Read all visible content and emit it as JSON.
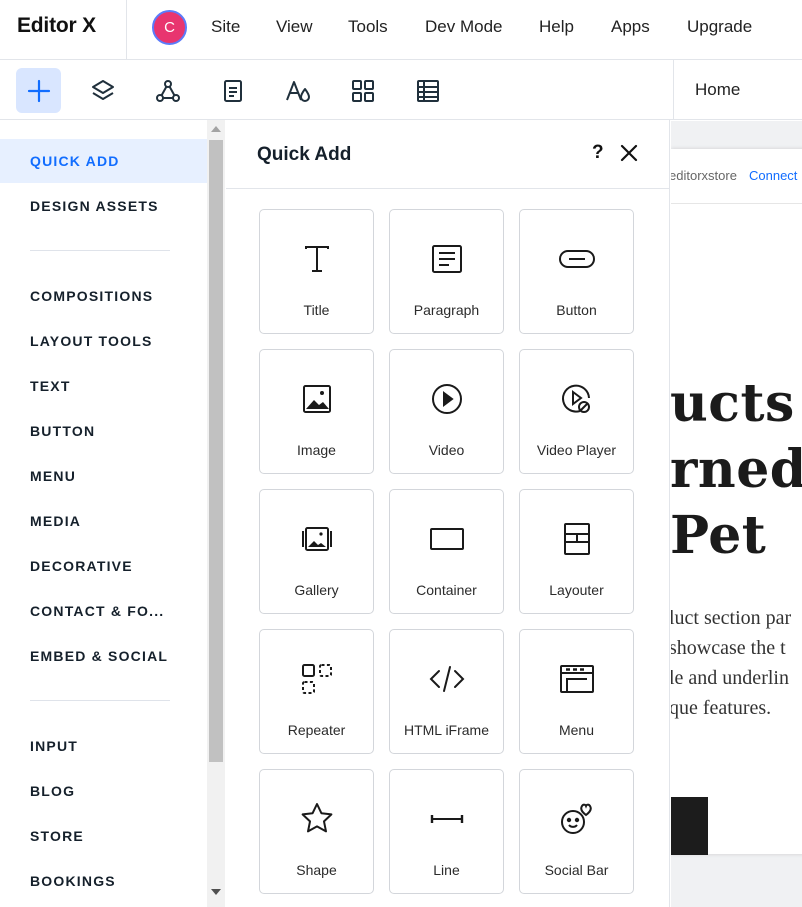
{
  "app": {
    "logo": "Editor X",
    "avatar_initial": "C",
    "menu": [
      "Site",
      "View",
      "Tools",
      "Dev Mode",
      "Help",
      "Apps",
      "Upgrade"
    ]
  },
  "toolbar": {
    "tools": [
      "add-plus-icon",
      "layers-icon",
      "connections-icon",
      "pages-icon",
      "design-assets-icon",
      "apps-grid-icon",
      "cms-table-icon"
    ],
    "active_tool": "add-plus-icon",
    "page": "Home"
  },
  "categories": {
    "group1": [
      "QUICK ADD",
      "DESIGN ASSETS"
    ],
    "group2": [
      "COMPOSITIONS",
      "LAYOUT TOOLS",
      "TEXT",
      "BUTTON",
      "MENU",
      "MEDIA",
      "DECORATIVE",
      "CONTACT & FO...",
      "EMBED & SOCIAL"
    ],
    "group3": [
      "INPUT",
      "BLOG",
      "STORE",
      "BOOKINGS"
    ],
    "active": "QUICK ADD"
  },
  "quick_add": {
    "title": "Quick Add",
    "help": "?",
    "items": [
      {
        "label": "Title",
        "icon": "title-t-icon"
      },
      {
        "label": "Paragraph",
        "icon": "paragraph-icon"
      },
      {
        "label": "Button",
        "icon": "button-icon"
      },
      {
        "label": "Image",
        "icon": "image-icon"
      },
      {
        "label": "Video",
        "icon": "video-play-icon"
      },
      {
        "label": "Video Player",
        "icon": "video-player-icon"
      },
      {
        "label": "Gallery",
        "icon": "gallery-icon"
      },
      {
        "label": "Container",
        "icon": "container-icon"
      },
      {
        "label": "Layouter",
        "icon": "layouter-icon"
      },
      {
        "label": "Repeater",
        "icon": "repeater-icon"
      },
      {
        "label": "HTML iFrame",
        "icon": "code-icon"
      },
      {
        "label": "Menu",
        "icon": "menu-icon"
      },
      {
        "label": "Shape",
        "icon": "star-shape-icon"
      },
      {
        "label": "Line",
        "icon": "line-icon"
      },
      {
        "label": "Social Bar",
        "icon": "social-bar-icon"
      }
    ]
  },
  "canvas": {
    "url": "editorxstore",
    "connect": "Connect",
    "hero_lines": [
      "ucts",
      "rned I",
      "Pet"
    ],
    "body_lines": [
      "luct section par",
      " showcase the t",
      "le and underlin",
      "que features."
    ]
  }
}
